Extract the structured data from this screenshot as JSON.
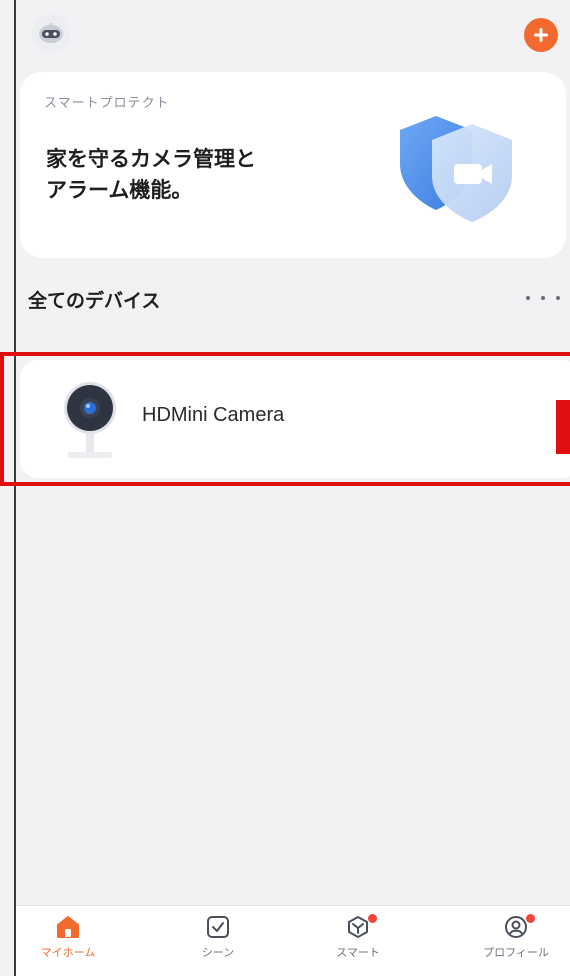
{
  "promo": {
    "subtitle": "スマートプロテクト",
    "title_line1": "家を守るカメラ管理と",
    "title_line2": "アラーム機能。"
  },
  "section": {
    "title": "全てのデバイス"
  },
  "devices": [
    {
      "name": "HDMini Camera"
    }
  ],
  "tabs": [
    {
      "label": "マイホーム",
      "active": true
    },
    {
      "label": "シーン",
      "active": false
    },
    {
      "label": "スマート",
      "active": false,
      "badge": true
    },
    {
      "label": "プロフィール",
      "active": false,
      "badge": true
    }
  ],
  "colors": {
    "accent": "#f26a2e",
    "highlight": "#e01010",
    "badge": "#f0453a"
  }
}
